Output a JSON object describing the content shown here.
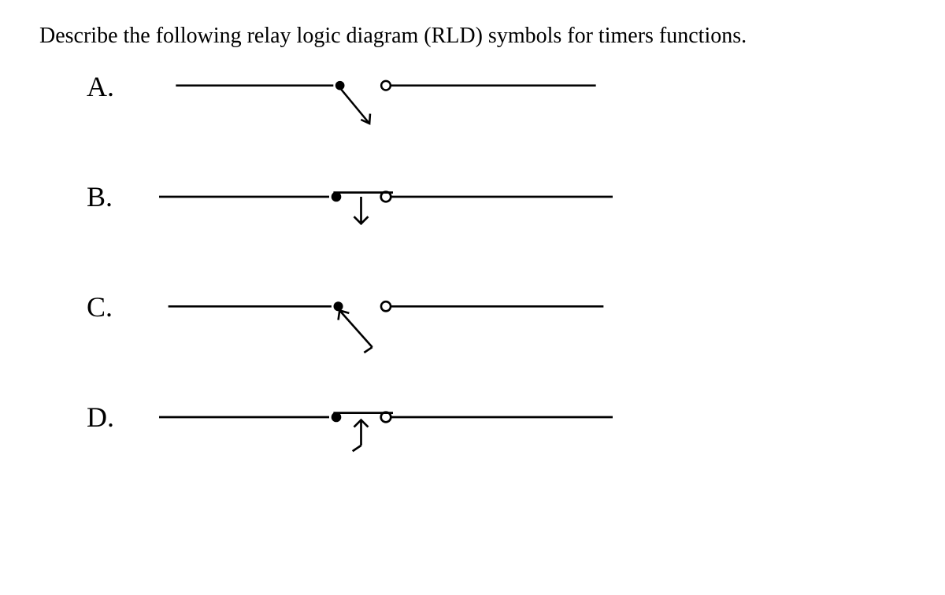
{
  "question": "Describe the following relay logic diagram (RLD) symbols for timers functions.",
  "items": [
    {
      "label": "A."
    },
    {
      "label": "B."
    },
    {
      "label": "C."
    },
    {
      "label": "D."
    }
  ]
}
